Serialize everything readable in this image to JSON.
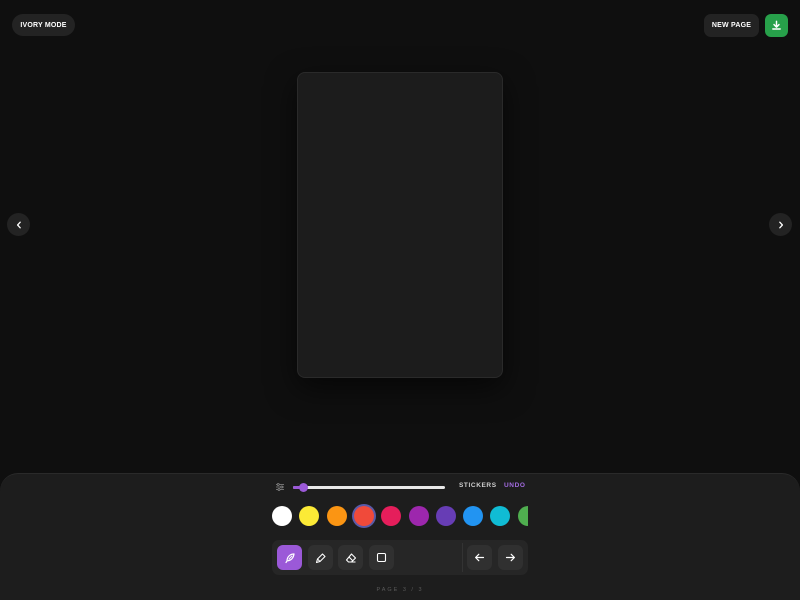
{
  "header": {
    "mode_button": "IVORY MODE",
    "new_page_button": "NEW PAGE",
    "download_icon": "download-icon"
  },
  "navigation": {
    "prev_icon": "chevron-left-icon",
    "next_icon": "chevron-right-icon"
  },
  "toolbar": {
    "settings_icon": "sliders-icon",
    "brush_size": 0.07,
    "stickers_label": "STICKERS",
    "undo_label": "UNDO",
    "colors": [
      {
        "name": "white",
        "hex": "#ffffff"
      },
      {
        "name": "yellow",
        "hex": "#fcea36"
      },
      {
        "name": "orange",
        "hex": "#fb9513"
      },
      {
        "name": "red",
        "hex": "#f04a3a",
        "selected": true
      },
      {
        "name": "crimson",
        "hex": "#e51e5b"
      },
      {
        "name": "purple",
        "hex": "#9d27ad"
      },
      {
        "name": "deep-purple",
        "hex": "#673db5"
      },
      {
        "name": "blue",
        "hex": "#2294f2"
      },
      {
        "name": "cyan",
        "hex": "#10bcd4"
      },
      {
        "name": "green",
        "hex": "#4fae4f"
      }
    ],
    "tools": [
      {
        "name": "feather-brush",
        "icon": "feather-icon",
        "active": true
      },
      {
        "name": "marker",
        "icon": "marker-icon",
        "active": false
      },
      {
        "name": "eraser",
        "icon": "eraser-icon",
        "active": false
      },
      {
        "name": "shape",
        "icon": "square-icon",
        "active": false
      }
    ],
    "actions": [
      {
        "name": "step-back",
        "icon": "arrow-left-icon"
      },
      {
        "name": "step-forward",
        "icon": "arrow-right-icon"
      }
    ]
  },
  "footer": {
    "page_indicator": "PAGE 3 / 3"
  },
  "colors": {
    "background": "#0f0f0f",
    "accent": "#9b59d8",
    "download_green": "#27a04a"
  }
}
